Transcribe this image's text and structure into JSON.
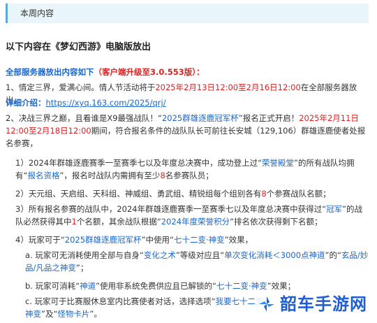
{
  "banner": {
    "title": "本周内容"
  },
  "headline": "以下内容在《梦幻西游》电脑版放出",
  "section": {
    "title": "全部服务器放出内容如下",
    "note": "（客户端升级至3.0.553版）："
  },
  "items": {
    "i1_a": "1、情定三界，爱满心间。情人节活动将于",
    "i1_date": "2025年2月13日12:00至2月16日12:00",
    "i1_b": "在全部服务器放出。",
    "detail_label": "详细介绍：",
    "detail_url": "https://xyq.163.com/2025/qrj/",
    "i2_a": "2、决战三界之巅，且看谁是X9最强战队！“",
    "i2_event": "2025群雄逐鹿冠军杯",
    "i2_b": "”报名正式开启！",
    "i2_date": "2025年2月11日12:00至2月18日12:00",
    "i2_c": "期间，符合报名条件的战队队长可前往长安城（129,106）群雄逐鹿使者处报名参赛，",
    "r1_a": "1）2024年群雄逐鹿赛季一至赛季七以及年度总决赛中，成功登上过“",
    "r1_hall": "荣誉殿堂",
    "r1_b": "”的所有战队均拥有“",
    "r1_qual": "报名资格",
    "r1_c": "”，报名时战队内需拥有至少",
    "r1_num": "8",
    "r1_d": "名参赛队员；",
    "r2_a": "2）天元组、天启组、天科组、神威组、勇武组、精锐组每个组别各有",
    "r2_num": "8",
    "r2_b": "个参赛战队名额；",
    "r3_a": "3）所有报名参赛的战队中，2024年群雄逐鹿赛季一至赛季七以及年度总决赛中获得过“",
    "r3_champ": "冠军",
    "r3_b": "”的战队必然获得其中",
    "r3_num": "1",
    "r3_c": "个名额，其余战队根据“",
    "r3_points": "2024年度荣誉积分",
    "r3_d": "”排名依次获得剩下名额；",
    "r4_a": "4）玩家可于“",
    "r4_event": "2025群雄逐鹿冠军杯",
    "r4_b": "”中使用“",
    "r4_trans": "七十二变·神变",
    "r4_c": "”效果，",
    "a_a": "a. 玩家可无消耗使用全部与自身“",
    "a_change": "变化之术",
    "a_b": "”等级对应且“",
    "a_cost": "单次变化消耗＜3000点神道",
    "a_c": "”的“",
    "a_card": "玄品/妙品/凡品之神变",
    "a_d": "”；",
    "b_a": "b. 玩家可消耗“",
    "b_shendao": "神道",
    "b_b": "”使用非系统免费供应且已解锁的“",
    "b_trans": "七十二变·神变",
    "b_c": "”效果；",
    "c_a": "c. 玩家可于比赛服休息室内比赛使者对话，选择选项“",
    "c_opt1": "我要七十二变·神变",
    "c_b": "”及“",
    "c_opt2": "怪物卡片",
    "c_c": "”。"
  },
  "watermark": {
    "text": "韶车手游网",
    "icon": "pinwheel-logo-icon"
  },
  "colors": {
    "blue": "#1a66c9",
    "red": "#e02020",
    "purple": "#7b3fb0",
    "banner_bg": "#eaf5fb"
  }
}
